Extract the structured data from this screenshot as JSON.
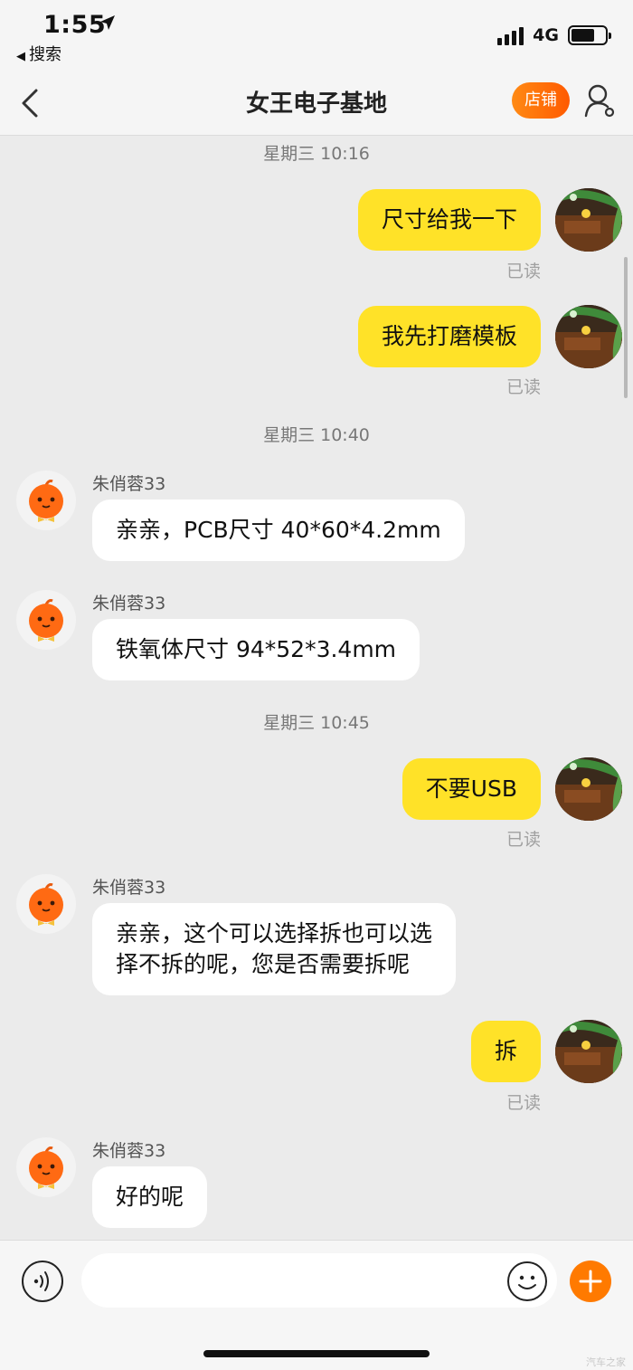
{
  "status_bar": {
    "time": "1:55",
    "back_app": "搜索",
    "network": "4G",
    "battery_level": 0.7
  },
  "nav": {
    "title": "女王电子基地",
    "shop_label": "店铺"
  },
  "messages": [
    {
      "type": "time",
      "text": "星期三 10:16"
    },
    {
      "type": "out",
      "text": "尺寸给我一下",
      "status": "已读"
    },
    {
      "type": "out",
      "text": "我先打磨模板",
      "status": "已读"
    },
    {
      "type": "time",
      "text": "星期三 10:40"
    },
    {
      "type": "in",
      "sender": "朱俏蓉33",
      "text": "亲亲，PCB尺寸 40*60*4.2mm"
    },
    {
      "type": "in",
      "sender": "朱俏蓉33",
      "text": "铁氧体尺寸 94*52*3.4mm"
    },
    {
      "type": "time",
      "text": "星期三 10:45"
    },
    {
      "type": "out",
      "text": "不要USB",
      "status": "已读"
    },
    {
      "type": "in",
      "sender": "朱俏蓉33",
      "lines": [
        "亲亲，这个可以选择拆也可以选",
        "择不拆的呢，您是否需要拆呢"
      ]
    },
    {
      "type": "out",
      "text": "拆",
      "status": "已读"
    },
    {
      "type": "in",
      "sender": "朱俏蓉33",
      "text": "好的呢"
    }
  ],
  "input": {
    "value": "",
    "placeholder": ""
  },
  "watermark": "汽车之家",
  "icons": {
    "back": "chevron-left-icon",
    "user": "user-settings-icon",
    "voice": "voice-icon",
    "emoji": "emoji-icon",
    "plus": "plus-icon"
  },
  "colors": {
    "outgoing_bubble": "#ffe228",
    "incoming_bubble": "#ffffff",
    "accent": "#ff7a00",
    "background": "#ebebeb"
  }
}
